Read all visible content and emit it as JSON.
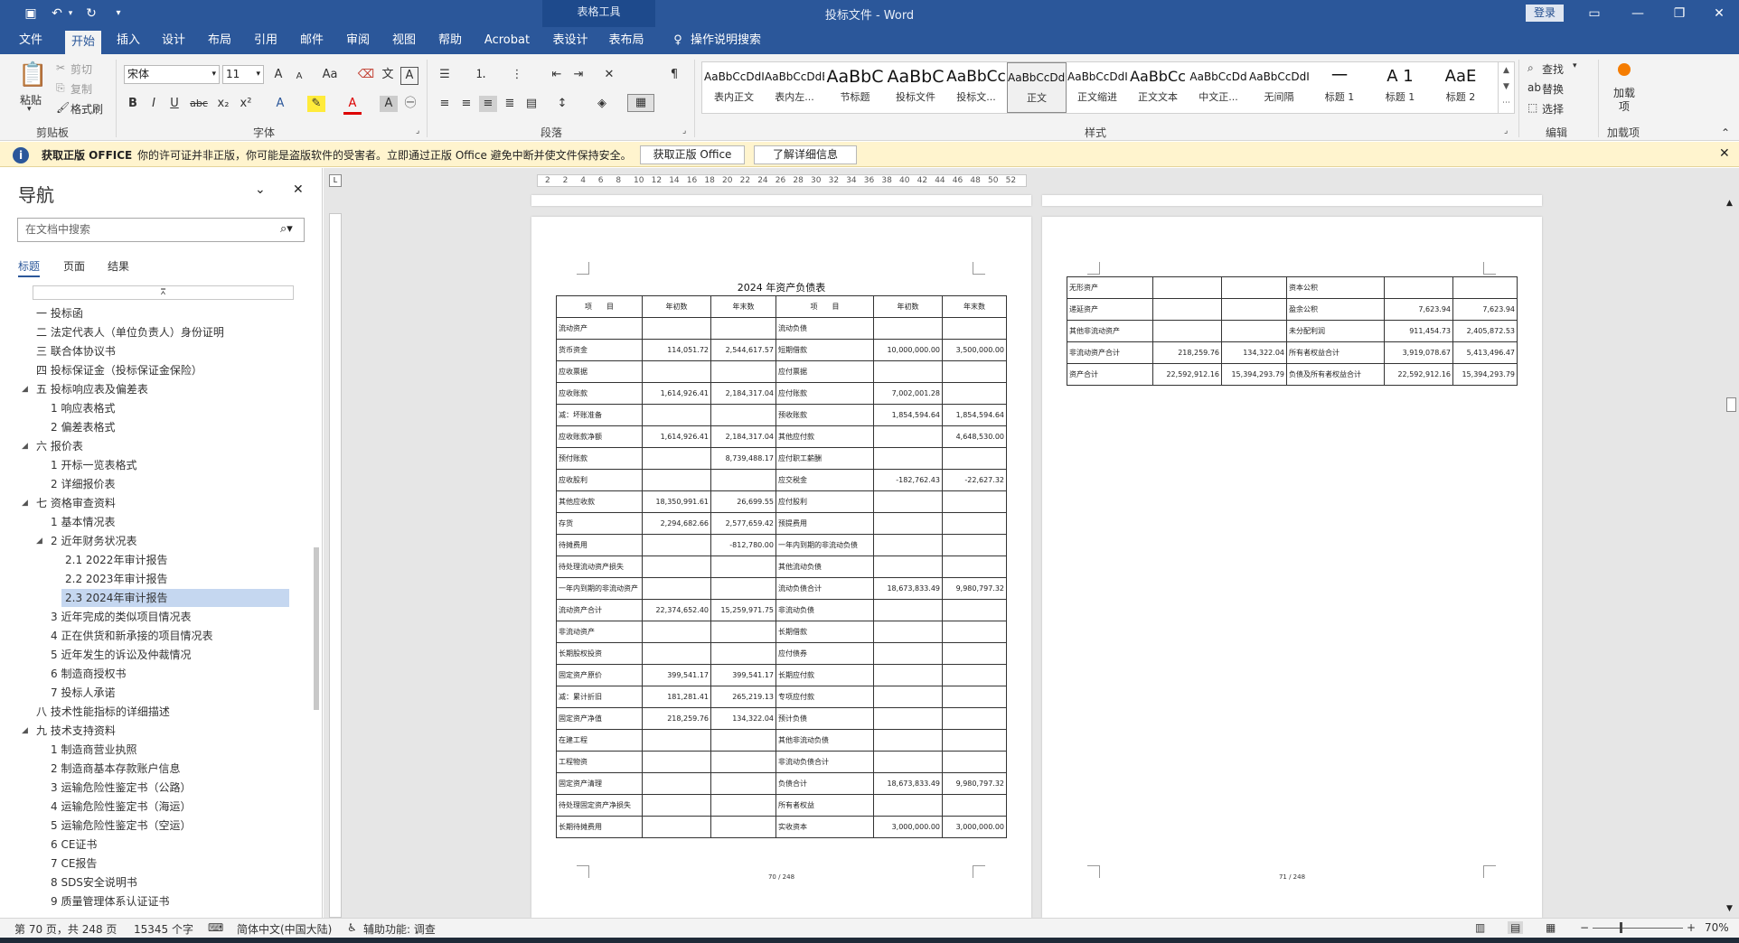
{
  "window": {
    "title": "投标文件 - Word",
    "context_tab_group": "表格工具",
    "login": "登录",
    "share": "共享"
  },
  "quick_access": {
    "save_icon": "save-icon",
    "undo_icon": "undo-icon",
    "redo_icon": "redo-icon",
    "customize_icon": "customize-icon"
  },
  "menu": {
    "file": "文件",
    "home": "开始",
    "insert": "插入",
    "design": "设计",
    "layout": "布局",
    "references": "引用",
    "mailings": "邮件",
    "review": "审阅",
    "view": "视图",
    "help": "帮助",
    "acrobat": "Acrobat",
    "table_design": "表设计",
    "table_layout": "表布局",
    "tell_me": "操作说明搜索"
  },
  "ribbon": {
    "clipboard": {
      "label": "剪贴板",
      "paste": "粘贴",
      "cut": "剪切",
      "copy": "复制",
      "format_painter": "格式刷"
    },
    "font": {
      "label": "字体",
      "name": "宋体",
      "size": "11",
      "grow": "A",
      "shrink": "A",
      "case": "Aa",
      "bold": "B",
      "italic": "I",
      "underline": "U",
      "strike": "abc",
      "sub": "x₂",
      "sup": "x²"
    },
    "paragraph": {
      "label": "段落"
    },
    "styles": {
      "label": "样式",
      "items": [
        {
          "preview": "AaBbCcDdI",
          "name": "表内正文",
          "size": 12
        },
        {
          "preview": "AaBbCcDdEe",
          "name": "表内左...",
          "size": 12
        },
        {
          "preview": "AaBbC",
          "name": "节标题",
          "size": 19
        },
        {
          "preview": "AaBbC",
          "name": "投标文件",
          "size": 19
        },
        {
          "preview": "AaBbCc",
          "name": "投标文...",
          "size": 17
        },
        {
          "preview": "AaBbCcDdI",
          "name": "正文",
          "size": 12
        },
        {
          "preview": "AaBbCcDdI",
          "name": "正文缩进",
          "size": 12
        },
        {
          "preview": "AaBbCc",
          "name": "正文文本",
          "size": 16
        },
        {
          "preview": "AaBbCcDd",
          "name": "中文正...",
          "size": 12
        },
        {
          "preview": "AaBbCcDdI",
          "name": "无间隔",
          "size": 12
        },
        {
          "preview": "一",
          "name": "标题 1",
          "size": 18
        },
        {
          "preview": "A 1",
          "name": "标题 1",
          "size": 18
        },
        {
          "preview": "AaE",
          "name": "标题 2",
          "size": 18
        }
      ]
    },
    "editing": {
      "label": "编辑",
      "find": "查找",
      "replace": "替换",
      "select": "选择"
    },
    "addins": {
      "label": "加载项",
      "button": "加载项"
    }
  },
  "infobar": {
    "title": "获取正版 OFFICE",
    "message": "你的许可证并非正版，你可能是盗版软件的受害者。立即通过正版 Office 避免中断并使文件保持安全。",
    "btn_get": "获取正版 Office",
    "btn_learn": "了解详细信息"
  },
  "nav": {
    "title": "导航",
    "search_placeholder": "在文档中搜索",
    "tabs": {
      "headings": "标题",
      "pages": "页面",
      "results": "结果"
    },
    "items": [
      {
        "text": "一 投标函",
        "level": 0,
        "caret": false
      },
      {
        "text": "二 法定代表人（单位负责人）身份证明",
        "level": 0,
        "caret": false
      },
      {
        "text": "三 联合体协议书",
        "level": 0,
        "caret": false
      },
      {
        "text": "四 投标保证金（投标保证金保险）",
        "level": 0,
        "caret": false
      },
      {
        "text": "五 投标响应表及偏差表",
        "level": 0,
        "caret": true
      },
      {
        "text": "1 响应表格式",
        "level": 1,
        "caret": false
      },
      {
        "text": "2 偏差表格式",
        "level": 1,
        "caret": false
      },
      {
        "text": "六 报价表",
        "level": 0,
        "caret": true
      },
      {
        "text": "1 开标一览表格式",
        "level": 1,
        "caret": false
      },
      {
        "text": "2 详细报价表",
        "level": 1,
        "caret": false
      },
      {
        "text": "七 资格审查资料",
        "level": 0,
        "caret": true
      },
      {
        "text": "1 基本情况表",
        "level": 1,
        "caret": false
      },
      {
        "text": "2 近年财务状况表",
        "level": 1,
        "caret": true
      },
      {
        "text": "2.1 2022年审计报告",
        "level": 2,
        "caret": false
      },
      {
        "text": "2.2 2023年审计报告",
        "level": 2,
        "caret": false
      },
      {
        "text": "2.3 2024年审计报告",
        "level": 2,
        "caret": false,
        "selected": true
      },
      {
        "text": "3 近年完成的类似项目情况表",
        "level": 1,
        "caret": false
      },
      {
        "text": "4 正在供货和新承接的项目情况表",
        "level": 1,
        "caret": false
      },
      {
        "text": "5 近年发生的诉讼及仲裁情况",
        "level": 1,
        "caret": false
      },
      {
        "text": "6 制造商授权书",
        "level": 1,
        "caret": false
      },
      {
        "text": "7 投标人承诺",
        "level": 1,
        "caret": false
      },
      {
        "text": "八 技术性能指标的详细描述",
        "level": 0,
        "caret": false
      },
      {
        "text": "九 技术支持资料",
        "level": 0,
        "caret": true
      },
      {
        "text": "1 制造商营业执照",
        "level": 1,
        "caret": false
      },
      {
        "text": "2 制造商基本存款账户信息",
        "level": 1,
        "caret": false
      },
      {
        "text": "3 运输危险性鉴定书（公路）",
        "level": 1,
        "caret": false
      },
      {
        "text": "4 运输危险性鉴定书（海运）",
        "level": 1,
        "caret": false
      },
      {
        "text": "5 运输危险性鉴定书（空运）",
        "level": 1,
        "caret": false
      },
      {
        "text": "6 CE证书",
        "level": 1,
        "caret": false
      },
      {
        "text": "7 CE报告",
        "level": 1,
        "caret": false
      },
      {
        "text": "8 SDS安全说明书",
        "level": 1,
        "caret": false
      },
      {
        "text": "9 质量管理体系认证证书",
        "level": 1,
        "caret": false
      }
    ]
  },
  "ruler": {
    "ticks": [
      "2",
      "2",
      "4",
      "6",
      "8",
      "10",
      "12",
      "14",
      "16",
      "18",
      "20",
      "22",
      "24",
      "26",
      "28",
      "30",
      "32",
      "34",
      "36",
      "38",
      "40",
      "42",
      "44",
      "46",
      "48",
      "50",
      "52"
    ]
  },
  "page1": {
    "title": "2024 年资产负债表",
    "headers": [
      "项　　目",
      "年初数",
      "年末数",
      "项　　目",
      "年初数",
      "年末数"
    ],
    "rows": [
      [
        "流动资产",
        "",
        "",
        "流动负债",
        "",
        ""
      ],
      [
        "货币资金",
        "114,051.72",
        "2,544,617.57",
        "短期借款",
        "10,000,000.00",
        "3,500,000.00"
      ],
      [
        "应收票据",
        "",
        "",
        "应付票据",
        "",
        ""
      ],
      [
        "应收账款",
        "1,614,926.41",
        "2,184,317.04",
        "应付账款",
        "7,002,001.28",
        ""
      ],
      [
        "减：坏账准备",
        "",
        "",
        "预收账款",
        "1,854,594.64",
        "1,854,594.64"
      ],
      [
        "应收账款净额",
        "1,614,926.41",
        "2,184,317.04",
        "其他应付款",
        "",
        "4,648,530.00"
      ],
      [
        "预付账款",
        "",
        "8,739,488.17",
        "应付职工薪酬",
        "",
        ""
      ],
      [
        "应收股利",
        "",
        "",
        "应交税金",
        "-182,762.43",
        "-22,627.32"
      ],
      [
        "其他应收款",
        "18,350,991.61",
        "26,699.55",
        "应付股利",
        "",
        ""
      ],
      [
        "存货",
        "2,294,682.66",
        "2,577,659.42",
        "预提费用",
        "",
        ""
      ],
      [
        "待摊费用",
        "",
        "-812,780.00",
        "一年内到期的非流动负债",
        "",
        ""
      ],
      [
        "待处理流动资产损失",
        "",
        "",
        "其他流动负债",
        "",
        ""
      ],
      [
        "一年内到期的非流动资产",
        "",
        "",
        "流动负债合计",
        "18,673,833.49",
        "9,980,797.32"
      ],
      [
        "流动资产合计",
        "22,374,652.40",
        "15,259,971.75",
        "非流动负债",
        "",
        ""
      ],
      [
        "非流动资产",
        "",
        "",
        "长期借款",
        "",
        ""
      ],
      [
        "长期股权投资",
        "",
        "",
        "应付债券",
        "",
        ""
      ],
      [
        "固定资产原价",
        "399,541.17",
        "399,541.17",
        "长期应付款",
        "",
        ""
      ],
      [
        "减：累计折旧",
        "181,281.41",
        "265,219.13",
        "专项应付款",
        "",
        ""
      ],
      [
        "固定资产净值",
        "218,259.76",
        "134,322.04",
        "预计负债",
        "",
        ""
      ],
      [
        "在建工程",
        "",
        "",
        "其他非流动负债",
        "",
        ""
      ],
      [
        "工程物资",
        "",
        "",
        "非流动负债合计",
        "",
        ""
      ],
      [
        "固定资产清理",
        "",
        "",
        "负债合计",
        "18,673,833.49",
        "9,980,797.32"
      ],
      [
        "待处理固定资产净损失",
        "",
        "",
        "所有者权益",
        "",
        ""
      ],
      [
        "长期待摊费用",
        "",
        "",
        "实收资本",
        "3,000,000.00",
        "3,000,000.00"
      ]
    ],
    "page_num": "70 / 248"
  },
  "page2": {
    "rows": [
      [
        "无形资产",
        "",
        "",
        "资本公积",
        "",
        ""
      ],
      [
        "递延资产",
        "",
        "",
        "盈余公积",
        "7,623.94",
        "7,623.94"
      ],
      [
        "其他非流动资产",
        "",
        "",
        "未分配利润",
        "911,454.73",
        "2,405,872.53"
      ],
      [
        "非流动资产合计",
        "218,259.76",
        "134,322.04",
        "所有者权益合计",
        "3,919,078.67",
        "5,413,496.47"
      ],
      [
        "资产合计",
        "22,592,912.16",
        "15,394,293.79",
        "负债及所有者权益合计",
        "22,592,912.16",
        "15,394,293.79"
      ]
    ],
    "page_num": "71 / 248"
  },
  "status": {
    "page": "第 70 页，共 248 页",
    "words": "15345 个字",
    "language": "简体中文(中国大陆)",
    "accessibility": "辅助功能: 调查",
    "zoom": "70%"
  },
  "colors": {
    "brand": "#2b579a",
    "ribbon_bg": "#f3f3f3",
    "infobar_bg": "#fff4ce",
    "nav_selected": "#c5d7f0",
    "doc_bg": "#e6e6e6"
  }
}
